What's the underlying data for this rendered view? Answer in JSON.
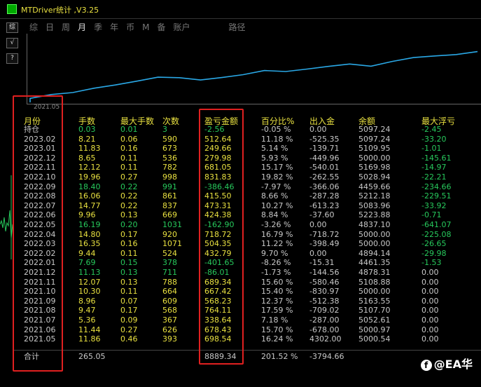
{
  "window": {
    "title": "MTDriver统计 ,V3.25"
  },
  "toolbar": {
    "btn1": "综",
    "btn2": "√",
    "btn3": "?"
  },
  "tabs": [
    {
      "label": "综",
      "active": false
    },
    {
      "label": "日",
      "active": false
    },
    {
      "label": "周",
      "active": false
    },
    {
      "label": "月",
      "active": true
    },
    {
      "label": "季",
      "active": false
    },
    {
      "label": "年",
      "active": false
    },
    {
      "label": "币",
      "active": false
    },
    {
      "label": "M",
      "active": false
    },
    {
      "label": "备",
      "active": false
    },
    {
      "label": "账户",
      "active": false
    }
  ],
  "path_label": "路径",
  "chart": {
    "start_label": "2021.05"
  },
  "chart_data": {
    "type": "line",
    "x": [
      "2021.05",
      "2021.06",
      "2021.07",
      "2021.08",
      "2021.09",
      "2021.10",
      "2021.11",
      "2021.12",
      "2022.01",
      "2022.02",
      "2022.03",
      "2022.04",
      "2022.05",
      "2022.06",
      "2022.07",
      "2022.08",
      "2022.09",
      "2022.10",
      "2022.11",
      "2022.12",
      "2023.01",
      "2023.02"
    ],
    "values": [
      698.54,
      1376.97,
      1715.61,
      2479.72,
      3047.95,
      3715.37,
      4404.71,
      4318.7,
      3917.05,
      4349.84,
      4854.19,
      5572.91,
      5410.01,
      5834.39,
      6307.7,
      6723.2,
      6336.74,
      7168.57,
      7849.62,
      8129.6,
      8379.26,
      8891.9
    ],
    "colors": {
      "line": "#2aa8e6"
    }
  },
  "headers": {
    "month": "月份",
    "lots": "手数",
    "maxlots": "最大手数",
    "count": "次数",
    "profit": "盈亏金额",
    "pct": "百分比%",
    "inout": "出入金",
    "balance": "余额",
    "float": "最大浮亏"
  },
  "rows": [
    {
      "month": "持仓",
      "lots": "0.03",
      "maxlots": "0.01",
      "count": "3",
      "profit": "-2.56",
      "pct": "-0.05 %",
      "inout": "0.00",
      "balance": "5097.24",
      "float": "-2.45",
      "c": "g"
    },
    {
      "month": "2023.02",
      "lots": "8.21",
      "maxlots": "0.06",
      "count": "590",
      "profit": "512.64",
      "pct": "11.18 %",
      "inout": "-525.35",
      "balance": "5097.24",
      "float": "-33.20",
      "c": "y"
    },
    {
      "month": "2023.01",
      "lots": "11.83",
      "maxlots": "0.16",
      "count": "673",
      "profit": "249.66",
      "pct": "5.14 %",
      "inout": "-139.71",
      "balance": "5109.95",
      "float": "-1.01",
      "c": "y"
    },
    {
      "month": "2022.12",
      "lots": "8.65",
      "maxlots": "0.11",
      "count": "536",
      "profit": "279.98",
      "pct": "5.93 %",
      "inout": "-449.96",
      "balance": "5000.00",
      "float": "-145.61",
      "c": "y"
    },
    {
      "month": "2022.11",
      "lots": "12.12",
      "maxlots": "0.11",
      "count": "782",
      "profit": "681.05",
      "pct": "15.17 %",
      "inout": "-540.01",
      "balance": "5169.98",
      "float": "-14.97",
      "c": "y"
    },
    {
      "month": "2022.10",
      "lots": "19.96",
      "maxlots": "0.27",
      "count": "998",
      "profit": "831.83",
      "pct": "19.82 %",
      "inout": "-262.55",
      "balance": "5028.94",
      "float": "-22.21",
      "c": "y"
    },
    {
      "month": "2022.09",
      "lots": "18.40",
      "maxlots": "0.22",
      "count": "991",
      "profit": "-386.46",
      "pct": "-7.97 %",
      "inout": "-366.06",
      "balance": "4459.66",
      "float": "-234.66",
      "c": "g"
    },
    {
      "month": "2022.08",
      "lots": "16.06",
      "maxlots": "0.22",
      "count": "861",
      "profit": "415.50",
      "pct": "8.66 %",
      "inout": "-287.28",
      "balance": "5212.18",
      "float": "-229.51",
      "c": "y"
    },
    {
      "month": "2022.07",
      "lots": "14.77",
      "maxlots": "0.22",
      "count": "837",
      "profit": "473.31",
      "pct": "10.27 %",
      "inout": "-613.23",
      "balance": "5083.96",
      "float": "-33.92",
      "c": "y"
    },
    {
      "month": "2022.06",
      "lots": "9.96",
      "maxlots": "0.13",
      "count": "669",
      "profit": "424.38",
      "pct": "8.84 %",
      "inout": "-37.60",
      "balance": "5223.88",
      "float": "-0.71",
      "c": "y"
    },
    {
      "month": "2022.05",
      "lots": "16.19",
      "maxlots": "0.20",
      "count": "1031",
      "profit": "-162.90",
      "pct": "-3.26 %",
      "inout": "0.00",
      "balance": "4837.10",
      "float": "-641.07",
      "c": "g"
    },
    {
      "month": "2022.04",
      "lots": "14.80",
      "maxlots": "0.17",
      "count": "920",
      "profit": "718.72",
      "pct": "16.79 %",
      "inout": "-718.72",
      "balance": "5000.00",
      "float": "-225.08",
      "c": "y"
    },
    {
      "month": "2022.03",
      "lots": "16.35",
      "maxlots": "0.16",
      "count": "1071",
      "profit": "504.35",
      "pct": "11.22 %",
      "inout": "-398.49",
      "balance": "5000.00",
      "float": "-26.65",
      "c": "y"
    },
    {
      "month": "2022.02",
      "lots": "9.44",
      "maxlots": "0.11",
      "count": "524",
      "profit": "432.79",
      "pct": "9.70 %",
      "inout": "0.00",
      "balance": "4894.14",
      "float": "-29.98",
      "c": "y"
    },
    {
      "month": "2022.01",
      "lots": "7.69",
      "maxlots": "0.15",
      "count": "378",
      "profit": "-401.65",
      "pct": "-8.26 %",
      "inout": "-15.31",
      "balance": "4461.35",
      "float": "-1.53",
      "c": "g"
    },
    {
      "month": "2021.12",
      "lots": "11.13",
      "maxlots": "0.13",
      "count": "711",
      "profit": "-86.01",
      "pct": "-1.73 %",
      "inout": "-144.56",
      "balance": "4878.31",
      "float": "0.00",
      "c": "g"
    },
    {
      "month": "2021.11",
      "lots": "12.07",
      "maxlots": "0.13",
      "count": "788",
      "profit": "689.34",
      "pct": "15.60 %",
      "inout": "-580.46",
      "balance": "5108.88",
      "float": "0.00",
      "c": "y"
    },
    {
      "month": "2021.10",
      "lots": "10.30",
      "maxlots": "0.11",
      "count": "664",
      "profit": "667.42",
      "pct": "15.40 %",
      "inout": "-830.97",
      "balance": "5000.00",
      "float": "0.00",
      "c": "y"
    },
    {
      "month": "2021.09",
      "lots": "8.96",
      "maxlots": "0.07",
      "count": "609",
      "profit": "568.23",
      "pct": "12.37 %",
      "inout": "-512.38",
      "balance": "5163.55",
      "float": "0.00",
      "c": "y"
    },
    {
      "month": "2021.08",
      "lots": "9.47",
      "maxlots": "0.17",
      "count": "568",
      "profit": "764.11",
      "pct": "17.59 %",
      "inout": "-709.02",
      "balance": "5107.70",
      "float": "0.00",
      "c": "y"
    },
    {
      "month": "2021.07",
      "lots": "5.36",
      "maxlots": "0.09",
      "count": "367",
      "profit": "338.64",
      "pct": "7.18 %",
      "inout": "-287.00",
      "balance": "5052.61",
      "float": "0.00",
      "c": "y"
    },
    {
      "month": "2021.06",
      "lots": "11.44",
      "maxlots": "0.27",
      "count": "626",
      "profit": "678.43",
      "pct": "15.70 %",
      "inout": "-678.00",
      "balance": "5000.97",
      "float": "0.00",
      "c": "y"
    },
    {
      "month": "2021.05",
      "lots": "11.86",
      "maxlots": "0.46",
      "count": "393",
      "profit": "698.54",
      "pct": "16.24 %",
      "inout": "4302.00",
      "balance": "5000.54",
      "float": "0.00",
      "c": "y"
    }
  ],
  "total": {
    "month": "合计",
    "lots": "265.05",
    "profit": "8889.34",
    "pct": "201.52 %",
    "inout": "-3794.66"
  },
  "watermark": "@EA华"
}
